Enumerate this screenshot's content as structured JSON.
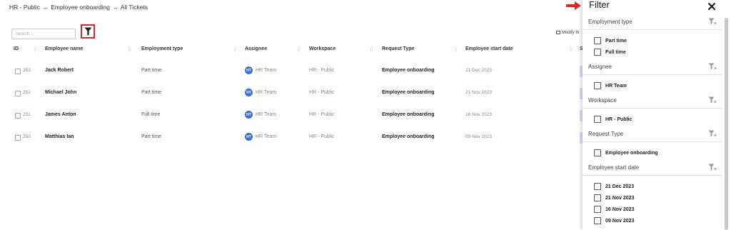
{
  "breadcrumb": {
    "items": [
      "HR - Public",
      "Employee onboarding",
      "All Tickets"
    ],
    "separator": "→"
  },
  "search": {
    "placeholder": "Search ..."
  },
  "toolbar": {
    "modify_label": "Modify th"
  },
  "table": {
    "headers": [
      "ID",
      "Employee name",
      "Employment type",
      "Assignee",
      "Workspace",
      "Request Type",
      "Employee start date"
    ],
    "peek_header": "S",
    "rows": [
      {
        "id": "253",
        "name": "Jack Robert",
        "employment_type": "Part time",
        "assignee_initials": "HT",
        "assignee": "HR Team",
        "workspace": "HR - Public",
        "request_type": "Employee onboarding",
        "start_date": "21 Dec 2023"
      },
      {
        "id": "252",
        "name": "Michael John",
        "employment_type": "Part time",
        "assignee_initials": "HT",
        "assignee": "HR Team",
        "workspace": "HR - Public",
        "request_type": "Employee onboarding",
        "start_date": "21 Nov 2023"
      },
      {
        "id": "251",
        "name": "James Anton",
        "employment_type": "Full time",
        "assignee_initials": "HT",
        "assignee": "HR Team",
        "workspace": "HR - Public",
        "request_type": "Employee onboarding",
        "start_date": "16 Nov 2023"
      },
      {
        "id": "250",
        "name": "Matthias Ian",
        "employment_type": "Part time",
        "assignee_initials": "HT",
        "assignee": "HR Team",
        "workspace": "HR - Public",
        "request_type": "Employee onboarding",
        "start_date": "09 Nov 2023"
      }
    ]
  },
  "filter_panel": {
    "title": "Filter",
    "sections": [
      {
        "label": "Employment type",
        "options": [
          "Part time",
          "Full time"
        ]
      },
      {
        "label": "Assignee",
        "options": [
          "HR Team"
        ]
      },
      {
        "label": "Workspace",
        "options": [
          "HR - Public"
        ]
      },
      {
        "label": "Request Type",
        "options": [
          "Employee onboarding"
        ]
      },
      {
        "label": "Employee start date",
        "options": [
          "21 Dec 2023",
          "21 Nov 2023",
          "16 Nov 2023",
          "09 Nov 2023"
        ]
      }
    ]
  },
  "colors": {
    "highlight": "#e02424",
    "avatar": "#3b6fd4",
    "accent_lavender": "#e1dcf4"
  },
  "icons": [
    "filter-funnel-icon",
    "close-icon",
    "arrow-right-icon",
    "clear-filter-icon",
    "columns-icon"
  ]
}
